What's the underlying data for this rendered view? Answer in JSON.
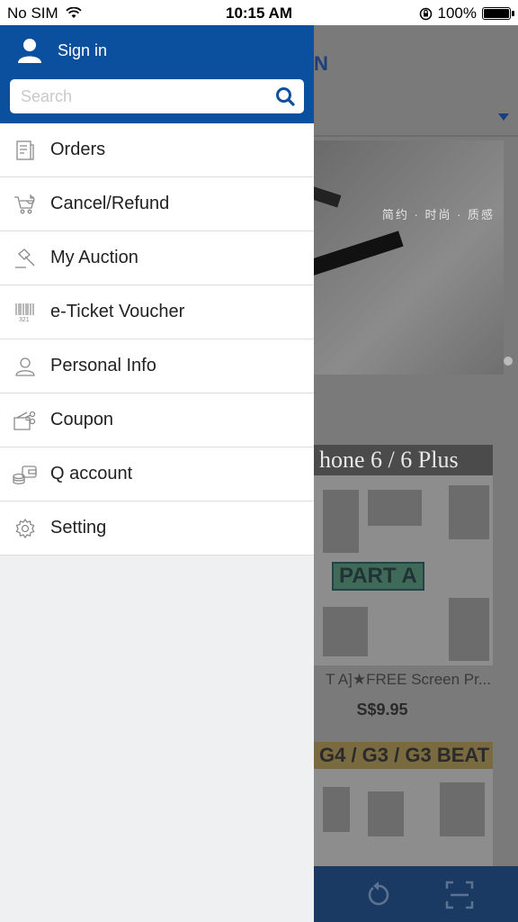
{
  "status_bar": {
    "carrier": "No SIM",
    "time": "10:15 AM",
    "battery": "100%"
  },
  "drawer": {
    "sign_in_label": "Sign in",
    "search": {
      "placeholder": "Search",
      "value": ""
    },
    "menu_items": [
      {
        "label": "Orders",
        "icon": "orders-icon"
      },
      {
        "label": "Cancel/Refund",
        "icon": "cart-refund-icon"
      },
      {
        "label": "My Auction",
        "icon": "gavel-icon"
      },
      {
        "label": "e-Ticket Voucher",
        "icon": "barcode-icon"
      },
      {
        "label": "Personal Info",
        "icon": "person-icon"
      },
      {
        "label": "Coupon",
        "icon": "coupon-icon"
      },
      {
        "label": "Q account",
        "icon": "wallet-icon"
      },
      {
        "label": "Setting",
        "icon": "gear-icon"
      }
    ]
  },
  "background_app": {
    "logo_fragment": "N",
    "banner_caption": "简约 · 时尚 · 质感",
    "product_1": {
      "header": "hone 6 / 6 Plus",
      "tag": "PART A",
      "name": "T A]★FREE Screen Pr...",
      "price": "S$9.95"
    },
    "product_2": {
      "header": "G4 / G3 / G3 BEAT"
    }
  },
  "colors": {
    "drawer_header": "#0b4f9f",
    "drawer_bg": "#eff0f2",
    "dim_overlay": "#7a7a7a",
    "bottom_bar": "#1b3a63"
  }
}
